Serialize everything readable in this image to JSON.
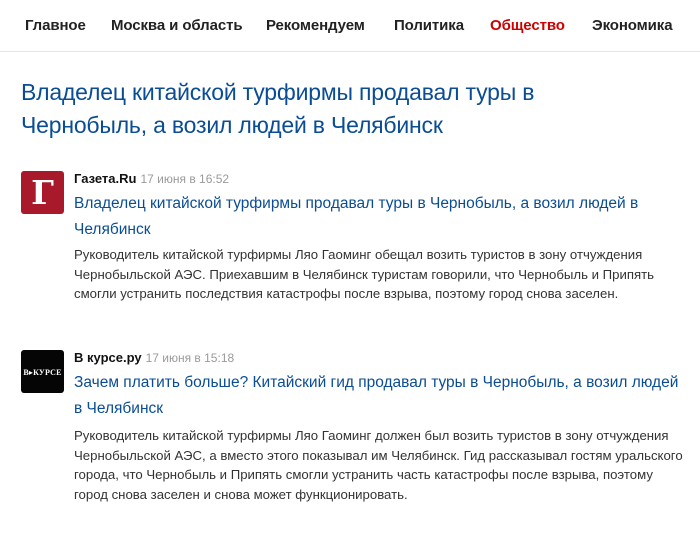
{
  "nav": {
    "items": [
      {
        "label": "Главное"
      },
      {
        "label": "Москва и область"
      },
      {
        "label": "Рекомендуем"
      },
      {
        "label": "Политика"
      },
      {
        "label": "Общество"
      },
      {
        "label": "Экономика"
      }
    ],
    "active_index": 4,
    "active_color": "#cc0000"
  },
  "headline": "Владелец китайской турфирмы продавал туры в Чернобыль, а возил людей в Челябинск",
  "stories": [
    {
      "logo_text": "Г",
      "logo_icon": "gazeta-ru-logo",
      "source": "Газета.Ru",
      "time": "17 июня в 16:52",
      "title": "Владелец китайской турфирмы продавал туры в Чернобыль, а возил людей в Челябинск",
      "snippet": "Руководитель китайской турфирмы Ляо Гаоминг обещал возить туристов в зону отчуждения Чернобыльской АЭС. Приехавшим в Челябинск туристам говорили, что Чернобыль и Припять смогли устранить последствия катастрофы после взрыва, поэтому город снова заселен."
    },
    {
      "logo_text": "В▸КУРСЕ",
      "logo_icon": "vkurse-logo",
      "source": "В курсе.ру",
      "time": "17 июня в 15:18",
      "title": "Зачем платить больше? Китайский гид продавал туры в Чернобыль, а возил людей в Челябинск",
      "snippet": "Руководитель китайской турфирмы Ляо Гаоминг должен был возить туристов в зону отчуждения Чернобыльской АЭС, а вместо этого показывал им Челябинск. Гид рассказывал гостям уральского города, что Чернобыль и Припять смогли устранить часть катастрофы после взрыва, поэтому город снова заселен и снова может функционировать."
    }
  ]
}
